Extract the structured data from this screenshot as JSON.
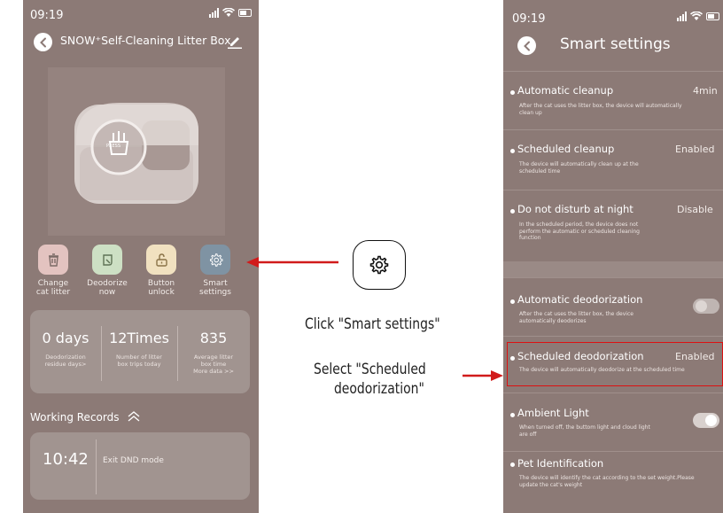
{
  "left_phone": {
    "status_time": "09:19",
    "status_battery": "5",
    "title": "SNOW⁺Self-Cleaning Litter Box",
    "press_label": "PRESS",
    "actions": [
      {
        "line1": "Change",
        "line2": "cat litter",
        "color": "#e3c3c0"
      },
      {
        "line1": "Deodorize",
        "line2": "now",
        "color": "#cde0c4"
      },
      {
        "line1": "Button",
        "line2": "unlock",
        "color": "#f1e1c0"
      },
      {
        "line1": "Smart",
        "line2": "settings",
        "color": "#7f93a3"
      }
    ],
    "stats": [
      {
        "value": "0 days",
        "label1": "Deodorization",
        "label2": "residue days>",
        "label3": ""
      },
      {
        "value": "12Times",
        "label1": "Number of litter",
        "label2": "box trips today",
        "label3": ""
      },
      {
        "value": "835",
        "label1": "Average litter",
        "label2": "box time",
        "label3": "More data >>"
      }
    ],
    "records_title": "Working Records",
    "record": {
      "time": "10:42",
      "event": "Exit DND mode"
    }
  },
  "annotations": {
    "click_caption": "Click \"Smart settings\"",
    "select_caption_line1": "Select \"Scheduled",
    "select_caption_line2": "deodorization\"",
    "arrow_color": "#d11b1b"
  },
  "right_phone": {
    "status_time": "09:19",
    "status_battery": "5",
    "title": "Smart settings",
    "rows": [
      {
        "title": "Automatic cleanup",
        "desc": "After the cat uses the litter box, the device will automatically clean up",
        "value": "4min"
      },
      {
        "title": "Scheduled cleanup",
        "desc": "The device will automatically clean up at the scheduled time",
        "value": "Enabled"
      },
      {
        "title": "Do not disturb at night",
        "desc": "In the scheduled period, the device does not perform the automatic or scheduled cleaning function",
        "value": "Disable"
      },
      {
        "title": "Automatic deodorization",
        "desc": "After the cat uses the litter box, the device automatically deodorizes",
        "toggle": false
      },
      {
        "title": "Scheduled deodorization",
        "desc": "The device will automatically deodorize at the scheduled time",
        "value": "Enabled"
      },
      {
        "title": "Ambient Light",
        "desc": "When turned off, the buttom light and cloud light are off",
        "toggle": true
      },
      {
        "title": "Pet Identification",
        "desc": "The device will identify the cat according to the set weight.Please update the cat's weight"
      }
    ]
  }
}
